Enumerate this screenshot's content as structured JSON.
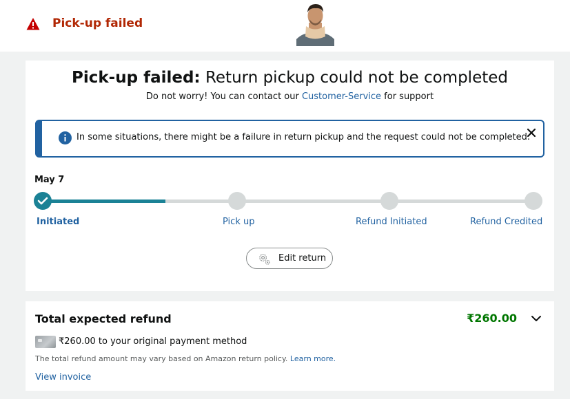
{
  "header": {
    "status_title": "Pick-up failed",
    "icon": "warning-icon"
  },
  "main": {
    "headline_bold": "Pick-up failed:",
    "headline_rest": " Return pickup could not be completed",
    "subtitle_before": "Do not worry! You can contact our ",
    "subtitle_link": "Customer-Service",
    "subtitle_after": " for support",
    "alert": {
      "text": "In some situations, there might be a failure in return pickup and the request could not be completed.",
      "icon": "info-icon"
    },
    "timeline": {
      "date": "May 7",
      "progress": 0.25,
      "steps": [
        {
          "label": "Initiated",
          "done": true
        },
        {
          "label": "Pick up",
          "done": false
        },
        {
          "label": "Refund Initiated",
          "done": false
        },
        {
          "label": "Refund Credited",
          "done": false
        }
      ]
    },
    "edit_button": "Edit return"
  },
  "refund": {
    "title": "Total expected refund",
    "amount": "₹260.00",
    "method_text": "₹260.00 to your original payment method",
    "policy_text": "The total refund amount may vary based on Amazon return policy. ",
    "policy_link": "Learn more.",
    "invoice_link": "View invoice"
  },
  "colors": {
    "alert_red": "#b12704",
    "link_blue": "#2162a1",
    "progress_teal": "#1b8296",
    "refund_green": "#007600"
  }
}
